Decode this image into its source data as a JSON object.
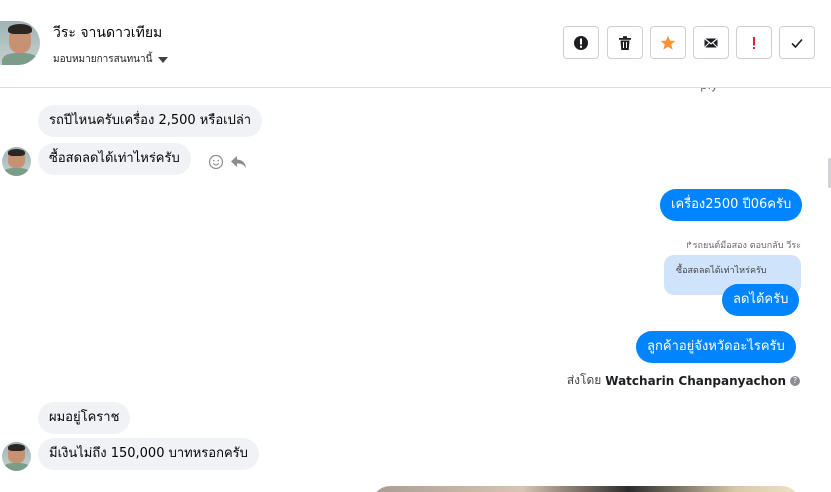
{
  "header": {
    "contact_name": "วีระ จานดาวเทียม",
    "assign_label": "มอบหมายการสนทนานี้",
    "actions": [
      {
        "name": "spam",
        "icon": "exclamation-circle-icon",
        "color": "#1c1e21"
      },
      {
        "name": "delete",
        "icon": "trash-icon",
        "color": "#1c1e21"
      },
      {
        "name": "star",
        "icon": "star-icon",
        "color": "#f7923a"
      },
      {
        "name": "mark-unread",
        "icon": "envelope-icon",
        "color": "#1c1e21"
      },
      {
        "name": "important",
        "icon": "exclamation-icon",
        "color": "#e41e3f"
      },
      {
        "name": "done",
        "icon": "check-icon",
        "color": "#1c1e21"
      }
    ]
  },
  "conversation": {
    "cutoff_text": "ply",
    "messages": [
      {
        "from": "contact",
        "text": "รถปีไหนครับเครื่อง 2,500 หรือเปล่า"
      },
      {
        "from": "contact",
        "text": "ซื้อสดลดได้เท่าไหร่ครับ"
      },
      {
        "from": "page",
        "text": "เครื่อง2500 ปี06ครับ"
      },
      {
        "from": "page",
        "reply_meta": "รถยนต์มือสอง ตอบกลับ วีระ",
        "quoted_text": "ซื้อสดลดได้เท่าไหร่ครับ",
        "text": "ลดได้ครับ"
      },
      {
        "from": "page",
        "text": "ลูกค้าอยู่จังหวัดอะไรครับ"
      },
      {
        "from": "contact",
        "text": "ผมอยู่โคราช"
      },
      {
        "from": "contact",
        "text": "มีเงินไม่ถึง 150,000 บาทหรอกครับ"
      }
    ],
    "sent_by_prefix": "ส่งโดย",
    "sent_by_name": "Watcharin Chanpanyachon",
    "info_icon": "?"
  },
  "colors": {
    "outgoing_bubble": "#0084ff",
    "incoming_bubble": "#f0f2f5",
    "quoted_bubble": "#cfe4fb"
  }
}
